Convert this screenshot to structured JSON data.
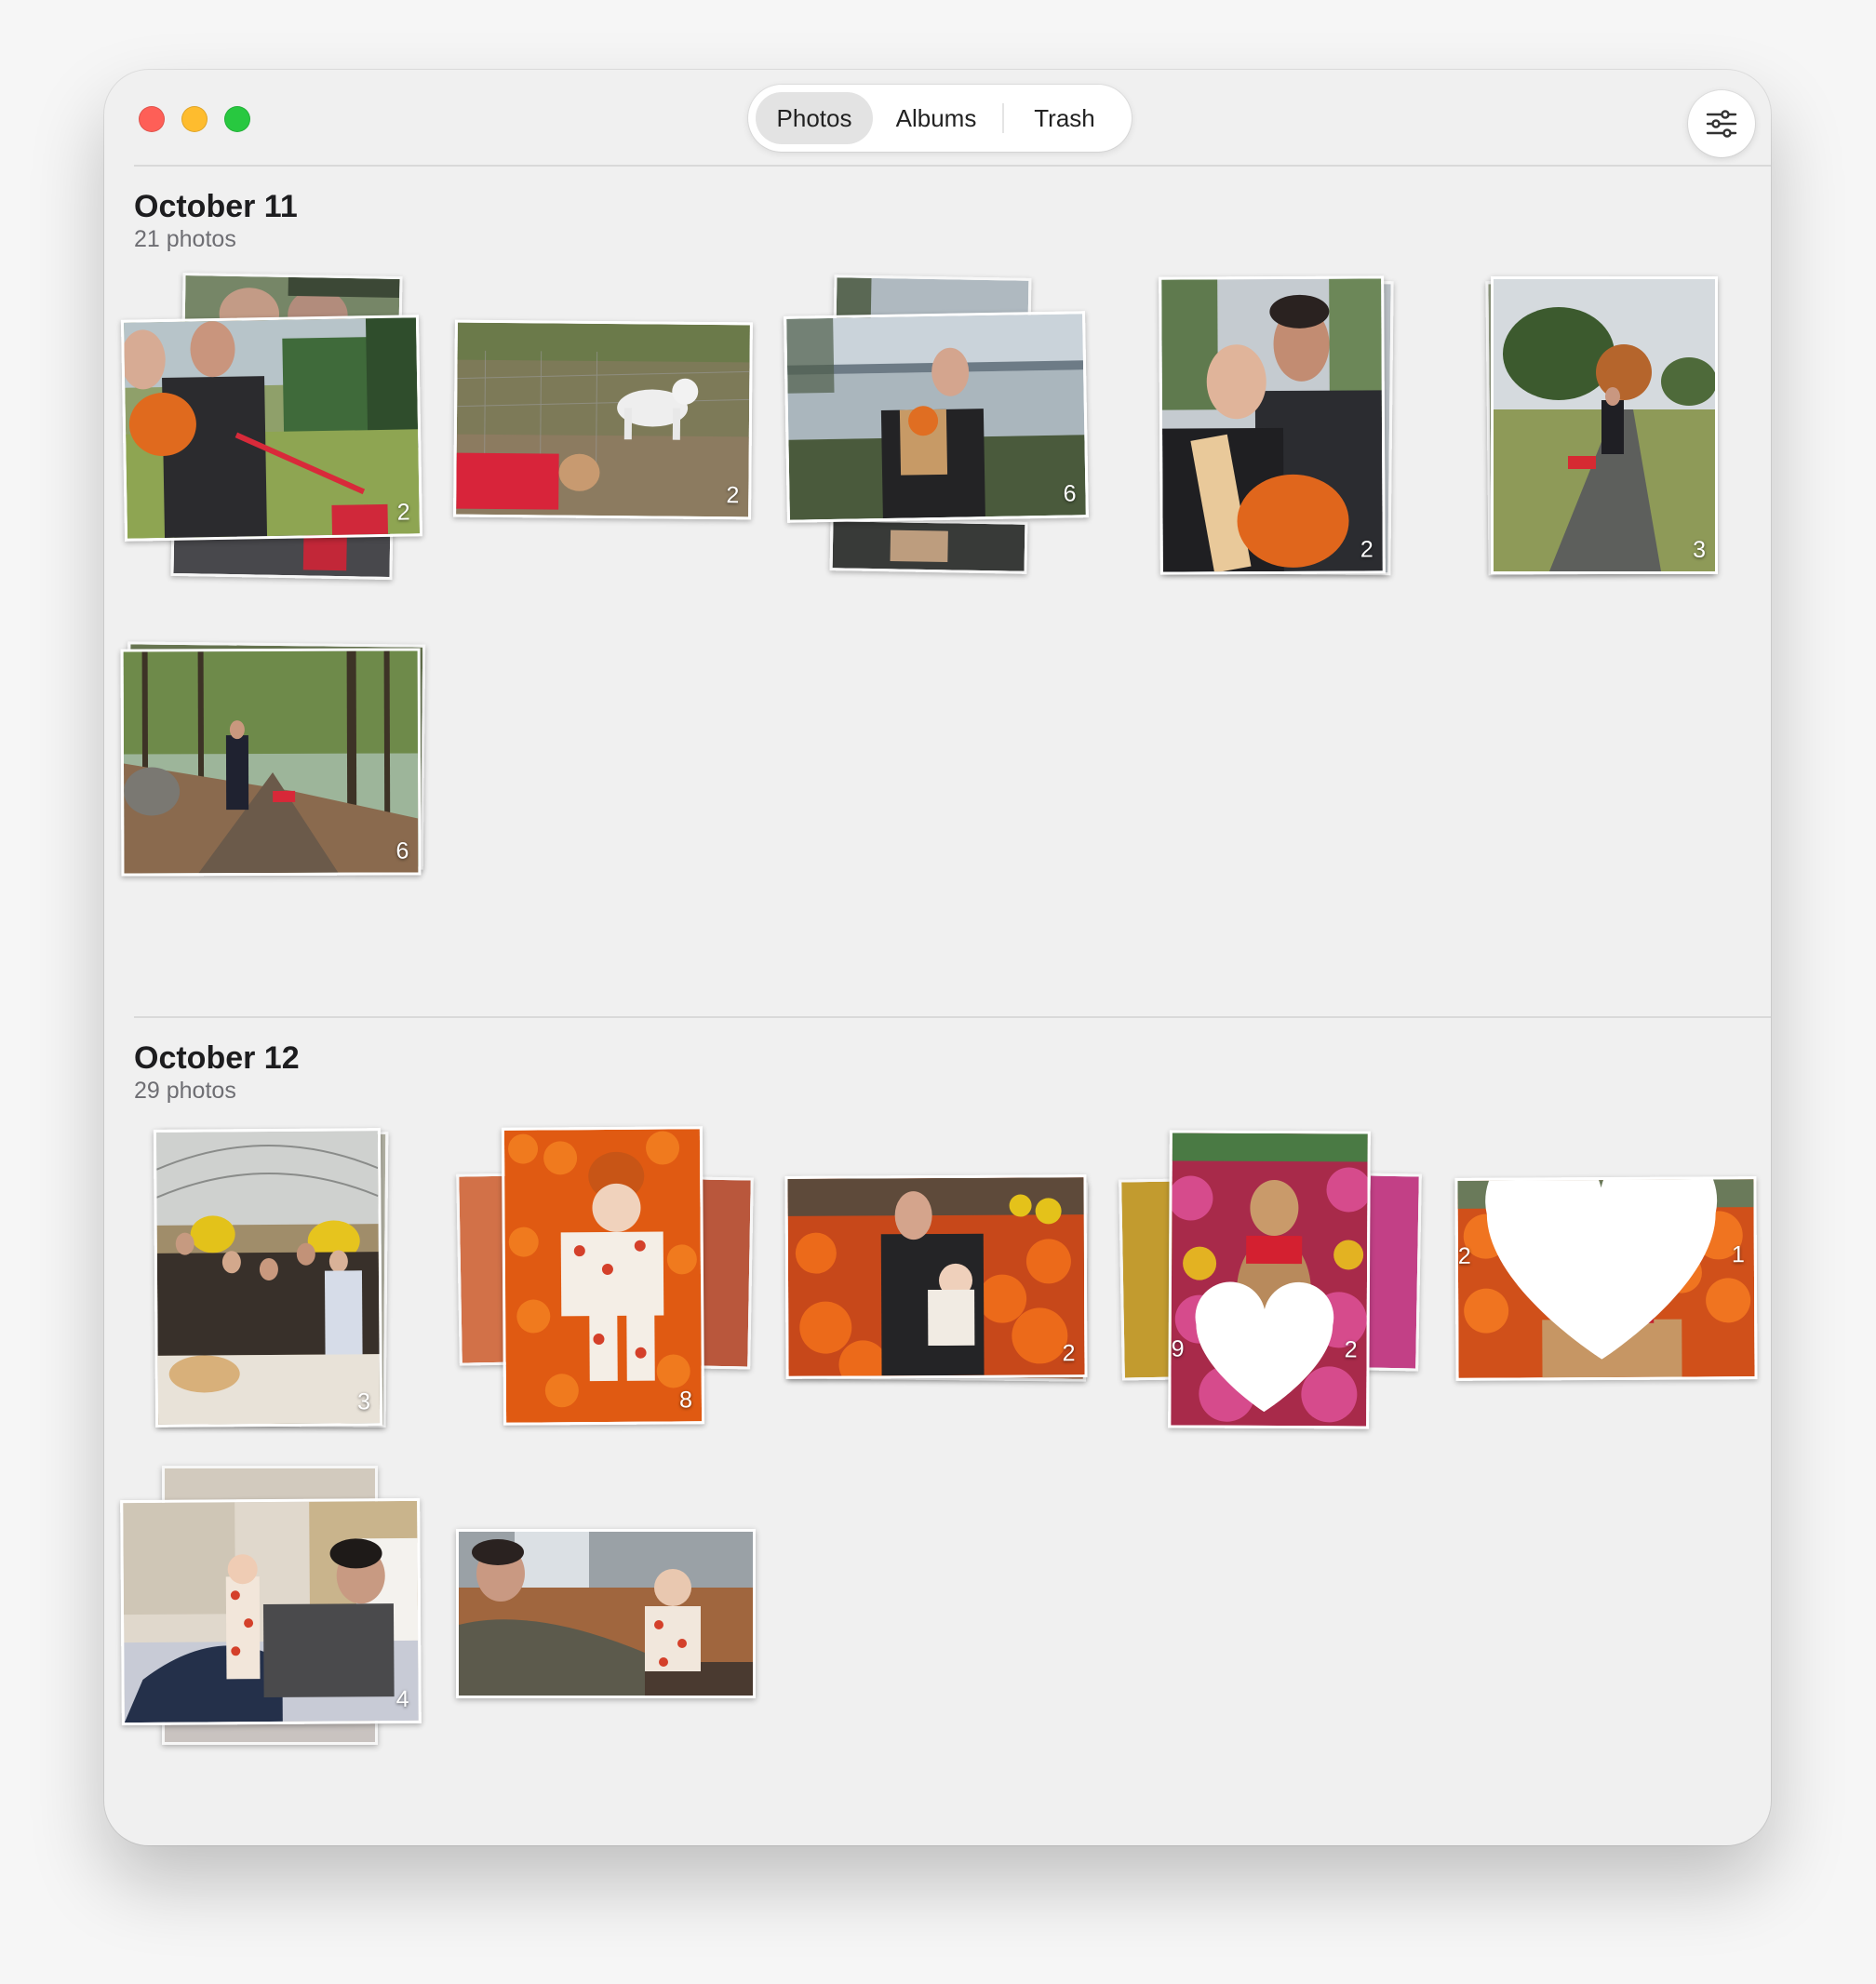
{
  "window": {
    "tabs": [
      {
        "label": "Photos",
        "selected": true
      },
      {
        "label": "Albums",
        "selected": false
      },
      {
        "label": "Trash",
        "selected": false
      }
    ],
    "filter_button_icon": "sliders-icon"
  },
  "sections": [
    {
      "title": "October 11",
      "count": "21 photos",
      "stacks": [
        {
          "badge": "2",
          "subject": "couple with dog on leash in park"
        },
        {
          "badge": "2",
          "subject": "dog in red sweater and white goat"
        },
        {
          "badge": "6",
          "subject": "woman with baby carrier by river"
        },
        {
          "badge": "2",
          "subject": "couple selfie with baby in pumpkin hat"
        },
        {
          "badge": "3",
          "subject": "man walking dog on gravel path"
        },
        {
          "badge": "6",
          "subject": "man walking dog on forest trail"
        }
      ]
    },
    {
      "title": "October 12",
      "count": "29 photos",
      "stacks": [
        {
          "badge": "3",
          "subject": "group photo with dog in greenhouse"
        },
        {
          "badge": "8",
          "subject": "baby lying on pumpkins"
        },
        {
          "badge": "2",
          "subject": "woman holding baby among pumpkins"
        },
        {
          "badge": "9",
          "hearts": "2",
          "subject": "dog among mums"
        },
        {
          "badge": "2",
          "hearts": "1",
          "subject": "dog in front of pumpkins"
        },
        {
          "badge": "4",
          "subject": "man holding baby on bed"
        },
        {
          "badge": "",
          "subject": "man holding baby on couch"
        }
      ]
    }
  ],
  "colors": {
    "window_bg": "#f0f0f0",
    "close": "#fe5f57",
    "minimize": "#febc2e",
    "maximize": "#28c840",
    "selected_tab": "#e3e3e3"
  }
}
